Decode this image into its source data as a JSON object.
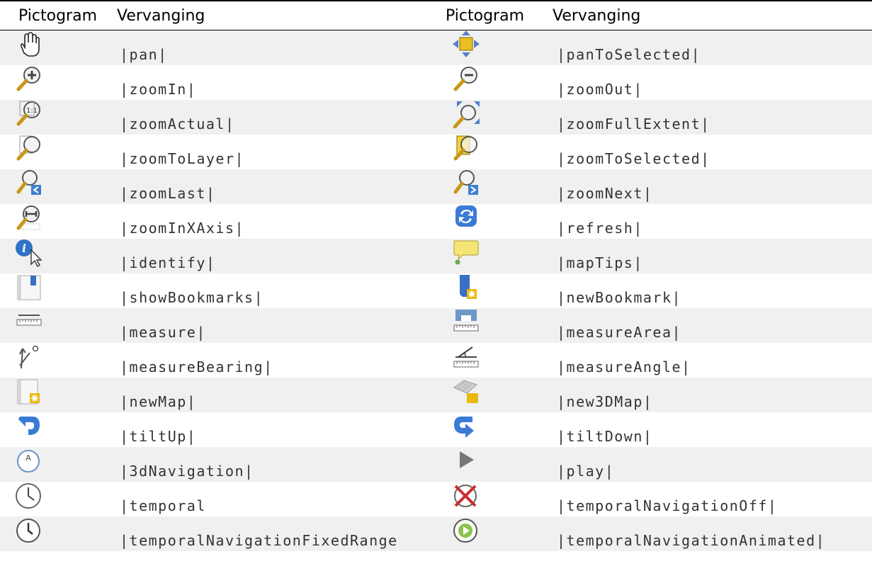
{
  "headers": {
    "icon_left": "Pictogram",
    "replacement_left": "Vervanging",
    "icon_right": "Pictogram",
    "replacement_right": "Vervanging"
  },
  "rows": [
    {
      "left_icon": "pan-hand-icon",
      "left_code": "|pan|",
      "right_icon": "pan-to-selected-icon",
      "right_code": "|panToSelected|"
    },
    {
      "left_icon": "zoom-in-icon",
      "left_code": "|zoomIn|",
      "right_icon": "zoom-out-icon",
      "right_code": "|zoomOut|"
    },
    {
      "left_icon": "zoom-actual-icon",
      "left_code": "|zoomActual|",
      "right_icon": "zoom-full-extent-icon",
      "right_code": "|zoomFullExtent|"
    },
    {
      "left_icon": "zoom-to-layer-icon",
      "left_code": "|zoomToLayer|",
      "right_icon": "zoom-to-selected-icon",
      "right_code": "|zoomToSelected|"
    },
    {
      "left_icon": "zoom-last-icon",
      "left_code": "|zoomLast|",
      "right_icon": "zoom-next-icon",
      "right_code": "|zoomNext|"
    },
    {
      "left_icon": "zoom-in-x-axis-icon",
      "left_code": "|zoomInXAxis|",
      "right_icon": "refresh-icon",
      "right_code": "|refresh|"
    },
    {
      "left_icon": "identify-icon",
      "left_code": "|identify|",
      "right_icon": "map-tips-icon",
      "right_code": "|mapTips|"
    },
    {
      "left_icon": "show-bookmarks-icon",
      "left_code": "|showBookmarks|",
      "right_icon": "new-bookmark-icon",
      "right_code": "|newBookmark|"
    },
    {
      "left_icon": "measure-icon",
      "left_code": "|measure|",
      "right_icon": "measure-area-icon",
      "right_code": "|measureArea|"
    },
    {
      "left_icon": "measure-bearing-icon",
      "left_code": "|measureBearing|",
      "right_icon": "measure-angle-icon",
      "right_code": "|measureAngle|"
    },
    {
      "left_icon": "new-map-icon",
      "left_code": "|newMap|",
      "right_icon": "new-3d-map-icon",
      "right_code": "|new3DMap|"
    },
    {
      "left_icon": "tilt-up-icon",
      "left_code": "|tiltUp|",
      "right_icon": "tilt-down-icon",
      "right_code": "|tiltDown|"
    },
    {
      "left_icon": "3d-navigation-icon",
      "left_code": "|3dNavigation|",
      "right_icon": "play-icon",
      "right_code": "|play|"
    },
    {
      "left_icon": "temporal-icon",
      "left_code": "|temporal",
      "right_icon": "temporal-navigation-off-icon",
      "right_code": "|temporalNavigationOff|"
    },
    {
      "left_icon": "temporal-fixed-range-icon",
      "left_code": "|temporalNavigationFixedRange",
      "right_icon": "temporal-animated-icon",
      "right_code": "|temporalNavigationAnimated|"
    }
  ]
}
